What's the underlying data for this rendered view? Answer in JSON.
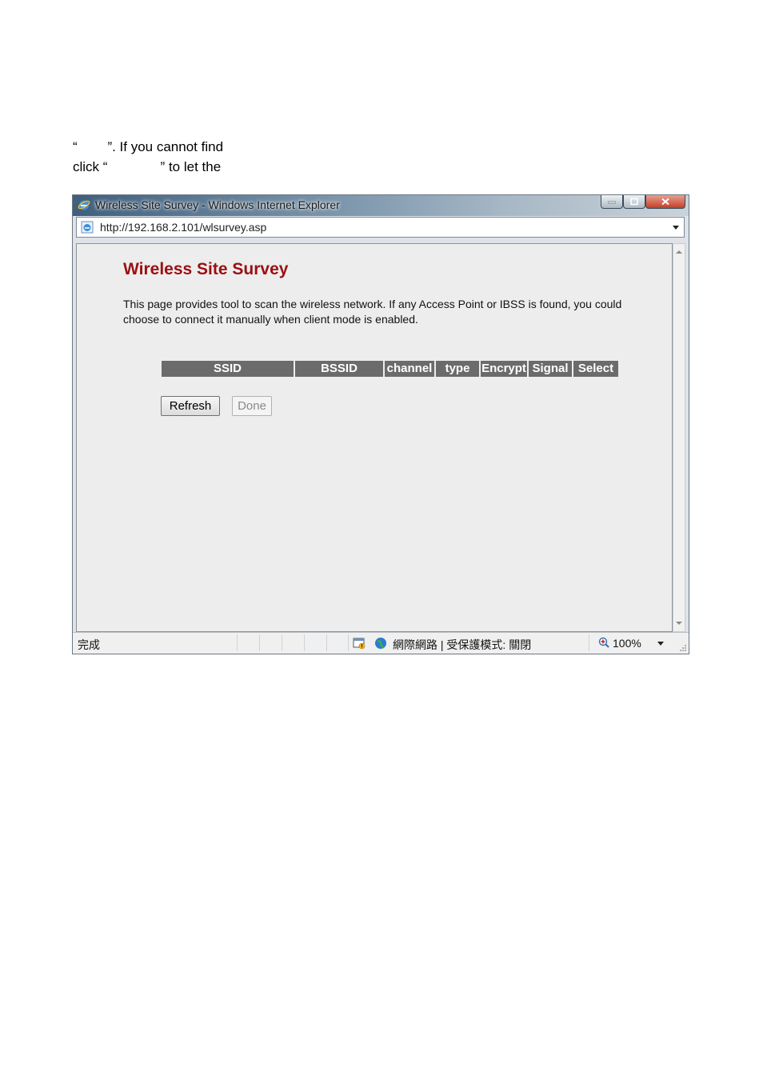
{
  "document": {
    "line1": "“        ”. If you cannot find",
    "line2": "click “              ” to let the"
  },
  "window": {
    "title": "Wireless Site Survey - Windows Internet Explorer",
    "url": "http://192.168.2.101/wlsurvey.asp"
  },
  "page": {
    "title": "Wireless Site Survey",
    "description": "This page provides tool to scan the wireless network. If any Access Point or IBSS is found, you could choose to connect it manually when client mode is enabled."
  },
  "survey_table": {
    "columns": [
      "SSID",
      "BSSID",
      "channel",
      "type",
      "Encrypt",
      "Signal",
      "Select"
    ],
    "rows": []
  },
  "buttons": {
    "refresh": "Refresh",
    "done": "Done"
  },
  "statusbar": {
    "status": "完成",
    "zone": "網際網路 | 受保護模式: 關閉",
    "zoom": "100%"
  },
  "colors": {
    "title_red": "#9b0f12",
    "table_header": "#6b6b6b",
    "content_bg": "#ededed"
  }
}
